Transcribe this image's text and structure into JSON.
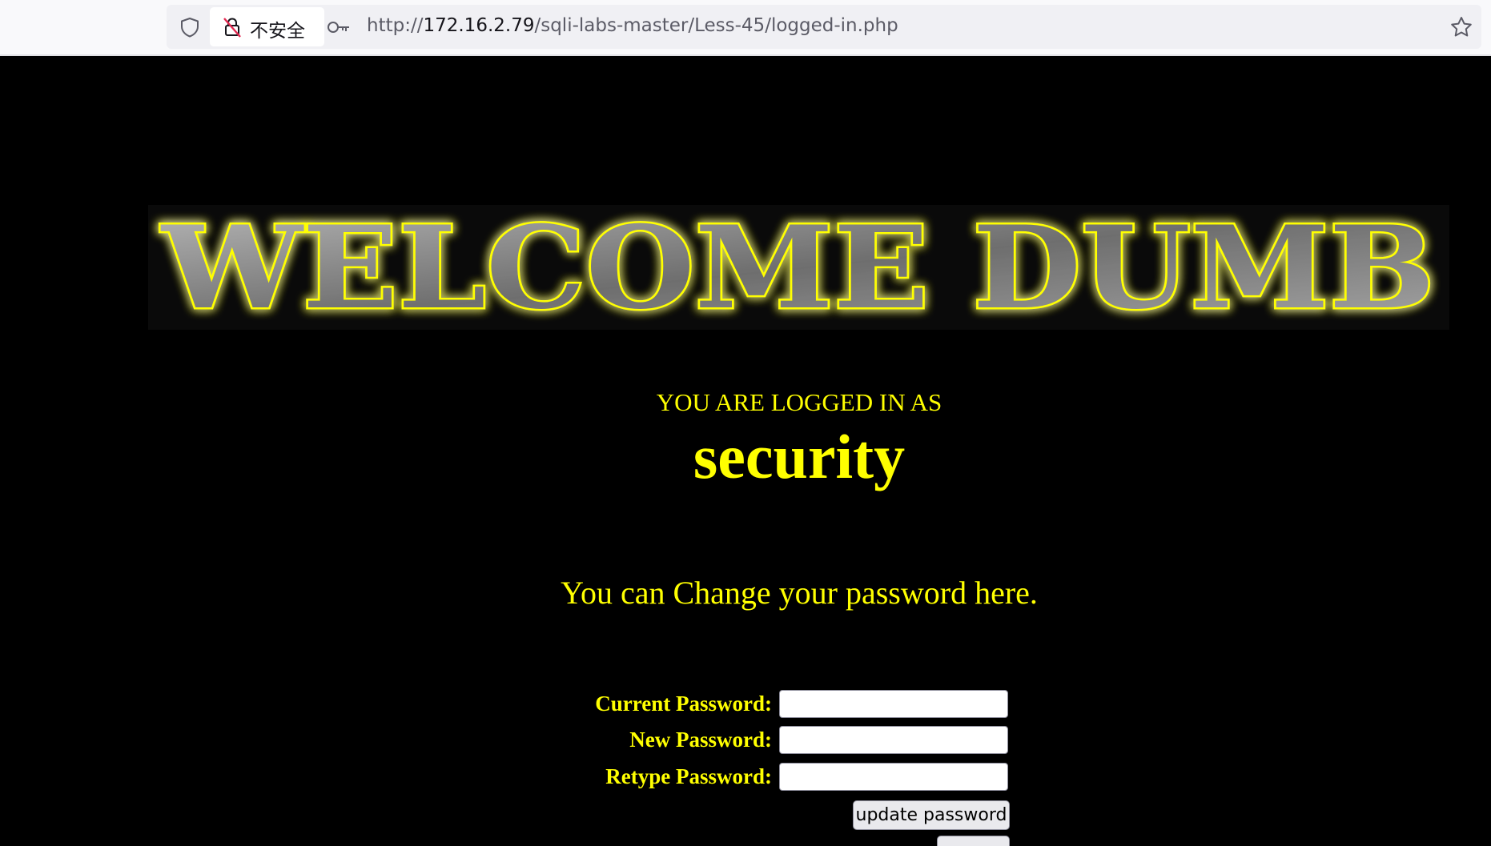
{
  "browser": {
    "security_label": "不安全",
    "url_scheme": "http://",
    "url_host": "172.16.2.79",
    "url_path": "/sqli-labs-master/Less-45/logged-in.php",
    "icons": [
      "shield-icon",
      "lock-warning-icon",
      "key-icon",
      "bookmark-star-icon"
    ]
  },
  "banner": {
    "text": "WELCOME DUMB",
    "glow_color": "#ffff00",
    "letter_color": "#8a8a8a"
  },
  "main": {
    "logged_in_label": "YOU ARE LOGGED IN AS",
    "username": "security",
    "change_heading": "You can Change your password here.",
    "text_color": "#ffff00",
    "background": "#000000"
  },
  "form": {
    "current_label": "Current Password:",
    "new_label": "New Password:",
    "retype_label": "Retype Password:",
    "current_value": "",
    "new_value": "",
    "retype_value": "",
    "submit_label": "update password"
  }
}
